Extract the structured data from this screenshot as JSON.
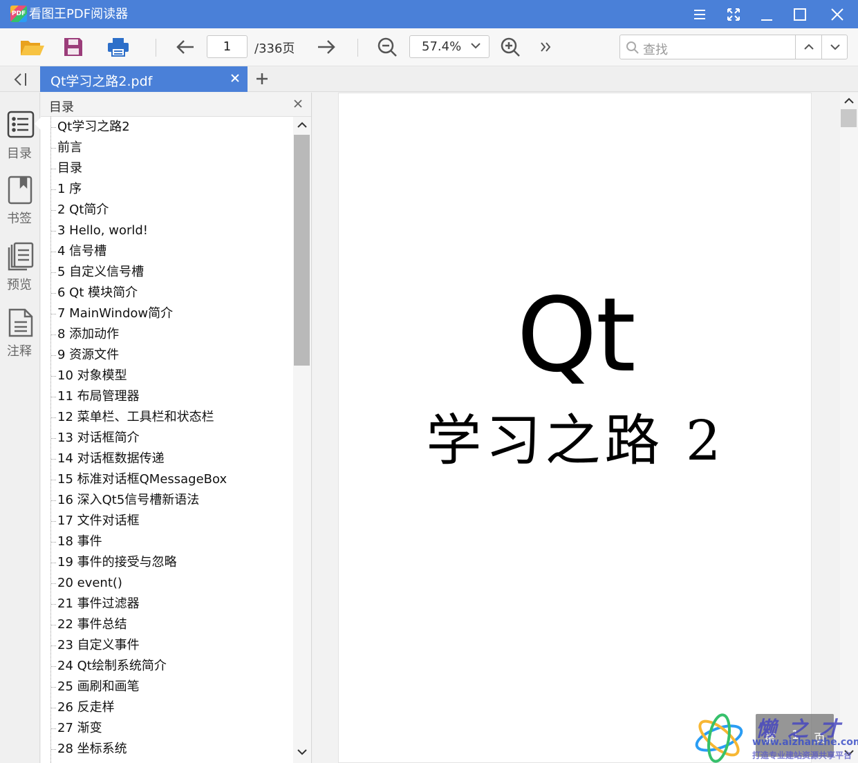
{
  "app": {
    "title": "看图王PDF阅读器",
    "logo_text": "PDF"
  },
  "toolbar": {
    "page_current": "1",
    "page_total": "/336页",
    "zoom": "57.4%",
    "search_placeholder": "查找"
  },
  "tab": {
    "label": "Qt学习之路2.pdf"
  },
  "rail": {
    "items": [
      {
        "label": "目录",
        "icon": "list-icon",
        "active": true
      },
      {
        "label": "书签",
        "icon": "bookmark-icon"
      },
      {
        "label": "预览",
        "icon": "thumbnails-icon"
      },
      {
        "label": "注释",
        "icon": "notes-icon"
      }
    ]
  },
  "toc": {
    "title": "目录",
    "items": [
      "Qt学习之路2",
      "前言",
      "目录",
      "1 序",
      "2 Qt简介",
      "3 Hello, world!",
      "4 信号槽",
      "5 自定义信号槽",
      "6 Qt 模块简介",
      "7 MainWindow简介",
      "8 添加动作",
      "9 资源文件",
      "10 对象模型",
      "11 布局管理器",
      "12 菜单栏、工具栏和状态栏",
      "13 对话框简介",
      "14 对话框数据传递",
      "15 标准对话框QMessageBox",
      "16 深入Qt5信号槽新语法",
      "17 文件对话框",
      "18 事件",
      "19 事件的接受与忽略",
      "20 event()",
      "21 事件过滤器",
      "22 事件总结",
      "23 自定义事件",
      "24 Qt绘制系统简介",
      "25 画刷和画笔",
      "26 反走样",
      "27 渐变",
      "28 坐标系统"
    ]
  },
  "document": {
    "cover_title": "Qt",
    "cover_subtitle": "学习之路 2"
  },
  "page_indicator": {
    "prefix": "第",
    "number": "1",
    "suffix": "页"
  },
  "watermark": {
    "name": "懒之才",
    "url": "www.aizhanzhe.com",
    "slogan": "打造专业建站资源共享平台"
  },
  "colors": {
    "titlebar": "#4a80d8",
    "tab_active": "#4a80d8",
    "accent_icon": "#2d6fc9"
  }
}
